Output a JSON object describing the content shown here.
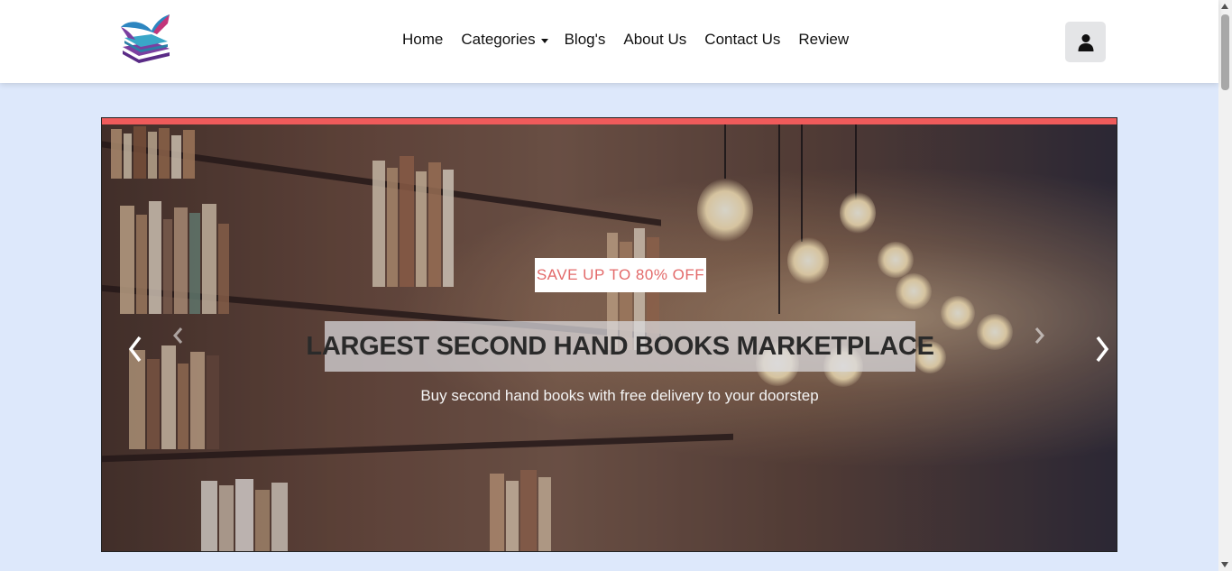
{
  "header": {
    "logo_alt": "bookstore logo",
    "nav": [
      {
        "label": "Home"
      },
      {
        "label": "Categories"
      },
      {
        "label": "Blog's"
      },
      {
        "label": "About Us"
      },
      {
        "label": "Contact Us"
      },
      {
        "label": "Review"
      }
    ],
    "user_icon": "user-icon"
  },
  "hero": {
    "badge": "SAVE UP TO 80% OFF",
    "headline": "LARGEST SECOND HAND BOOKS MARKETPLACE",
    "subheadline": "Buy second hand books with free delivery to your doorstep",
    "prev_icon": "chevron-left-icon",
    "next_icon": "chevron-right-icon"
  },
  "colors": {
    "page_bg": "#dde8fb",
    "accent_bar": "#ef5b5b",
    "badge_text": "#e36a6a",
    "header_bg": "#ffffff"
  }
}
